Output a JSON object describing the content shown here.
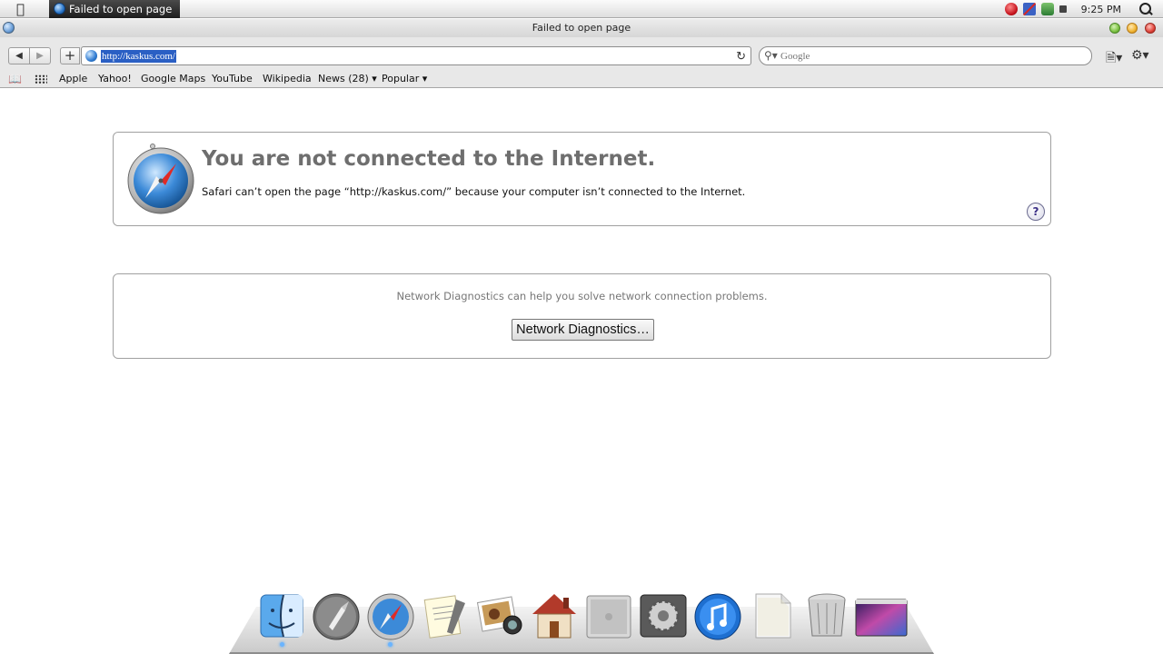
{
  "taskbar": {
    "task_title": "Failed to open page",
    "clock": "9:25 PM"
  },
  "window": {
    "title": "Failed to open page"
  },
  "toolbar": {
    "back_label": "◀",
    "forward_label": "▶",
    "add_label": "+",
    "url": "http://kaskus.com/",
    "search_placeholder": "Google"
  },
  "bookmarks": {
    "items": [
      "Apple",
      "Yahoo!",
      "Google Maps",
      "YouTube",
      "Wikipedia",
      "News (28) ▾",
      "Popular ▾"
    ]
  },
  "error": {
    "heading": "You are not connected to the Internet.",
    "message": "Safari can’t open the page “http://kaskus.com/” because your computer isn’t connected to the Internet.",
    "help_label": "?"
  },
  "diagnostics": {
    "text": "Network Diagnostics can help you solve network connection problems.",
    "button_label": "Network Diagnostics…"
  },
  "dock": {
    "items": [
      "finder-icon",
      "launchpad-icon",
      "safari-icon",
      "textedit-icon",
      "photo-booth-icon",
      "home-icon",
      "mac-pro-icon",
      "system-preferences-icon",
      "itunes-icon",
      "document-icon",
      "trash-icon",
      "desktop-icon"
    ]
  },
  "colors": {
    "url_highlight": "#2a5fc4",
    "heading_gray": "#6e6e6e",
    "close": "#e0443a",
    "minimize": "#f0b330",
    "zoom": "#7cc242"
  }
}
